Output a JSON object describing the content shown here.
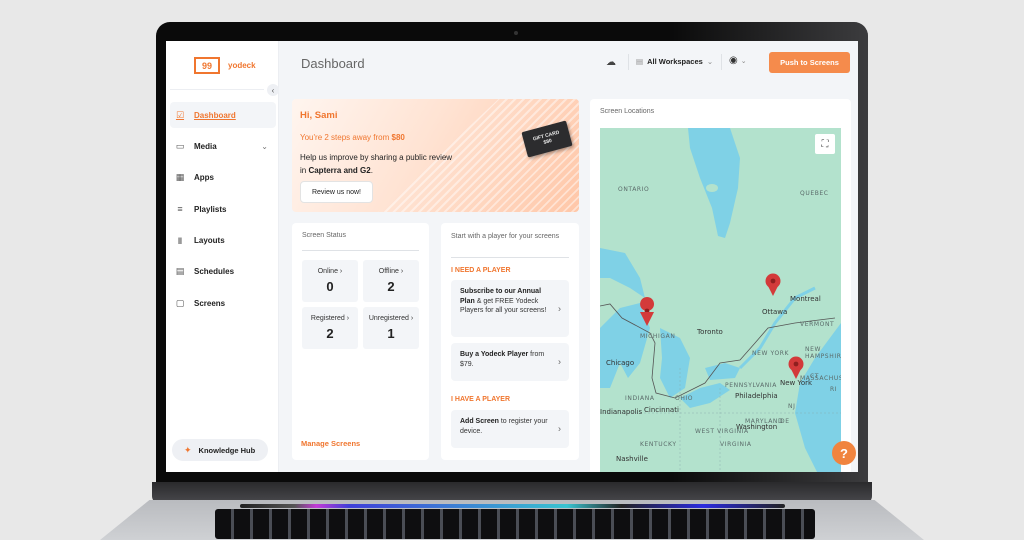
{
  "app": {
    "brand": "yodeck",
    "logo_glyph": "99"
  },
  "sidebar": {
    "collapse_glyph": "‹",
    "items": [
      {
        "label": "Dashboard",
        "icon": "dashboard-icon",
        "glyph": "☑",
        "active": true
      },
      {
        "label": "Media",
        "icon": "folder-icon",
        "glyph": "▭",
        "chevron": "⌄"
      },
      {
        "label": "Apps",
        "icon": "apps-grid-icon",
        "glyph": "▦"
      },
      {
        "label": "Playlists",
        "icon": "playlist-add-icon",
        "glyph": "≡"
      },
      {
        "label": "Layouts",
        "icon": "layouts-icon",
        "glyph": "‖"
      },
      {
        "label": "Schedules",
        "icon": "calendar-icon",
        "glyph": "▤"
      },
      {
        "label": "Screens",
        "icon": "monitor-icon",
        "glyph": "▢"
      }
    ],
    "knowledge_hub": {
      "label": "Knowledge Hub",
      "glyph": "✦"
    }
  },
  "header": {
    "title": "Dashboard",
    "cloud_glyph": "☁",
    "workspace": {
      "label": "All Workspaces",
      "glyph": "▤",
      "chevron": "⌄"
    },
    "user": {
      "glyph": "◉",
      "chevron": "⌄"
    },
    "push_button": "Push to Screens"
  },
  "promo": {
    "greeting": "Hi, Sami",
    "steps_prefix": "You're 2 steps away from ",
    "steps_amount": "$80",
    "text_prefix": "Help us improve by sharing a public review in ",
    "text_bold": "Capterra and G2",
    "text_suffix": ".",
    "button": "Review us now!",
    "gift_card_line1": "GIFT CARD",
    "gift_card_line2": "$80"
  },
  "screen_status": {
    "title": "Screen Status",
    "stats": [
      {
        "label": "Online ›",
        "value": "0"
      },
      {
        "label": "Offline ›",
        "value": "2"
      },
      {
        "label": "Registered ›",
        "value": "2"
      },
      {
        "label": "Unregistered ›",
        "value": "1"
      }
    ],
    "manage_link": "Manage Screens"
  },
  "player": {
    "title": "Start with a player for your screens",
    "need_label": "I NEED A PLAYER",
    "have_label": "I HAVE A PLAYER",
    "options": [
      {
        "bold": "Subscribe to our Annual Plan",
        "rest": " & get FREE Yodeck Players for all your screens!"
      },
      {
        "bold": "Buy a Yodeck Player",
        "rest": " from $79."
      },
      {
        "bold": "Add Screen",
        "rest": " to register your device."
      }
    ],
    "chevron": "›"
  },
  "map": {
    "title": "Screen Locations",
    "fullscreen_glyph": "⛶",
    "regions": [
      "ONTARIO",
      "QUEBEC",
      "MICHIGAN",
      "NEW YORK",
      "VERMONT",
      "NEW HAMPSHIRE",
      "MASSACHUSETTS",
      "PENNSYLVANIA",
      "INDIANA",
      "OHIO",
      "MARYLAND",
      "WEST VIRGINIA",
      "KENTUCKY",
      "VIRGINIA",
      "CT",
      "RI",
      "NJ",
      "DE"
    ],
    "cities": [
      "Montreal",
      "Ottawa",
      "Toronto",
      "Chicago",
      "New York",
      "Philadelphia",
      "Cincinnati",
      "Indianapolis",
      "Washington",
      "Nashville"
    ],
    "pins": [
      "Michigan",
      "Ottawa",
      "New York"
    ]
  },
  "help_glyph": "?"
}
